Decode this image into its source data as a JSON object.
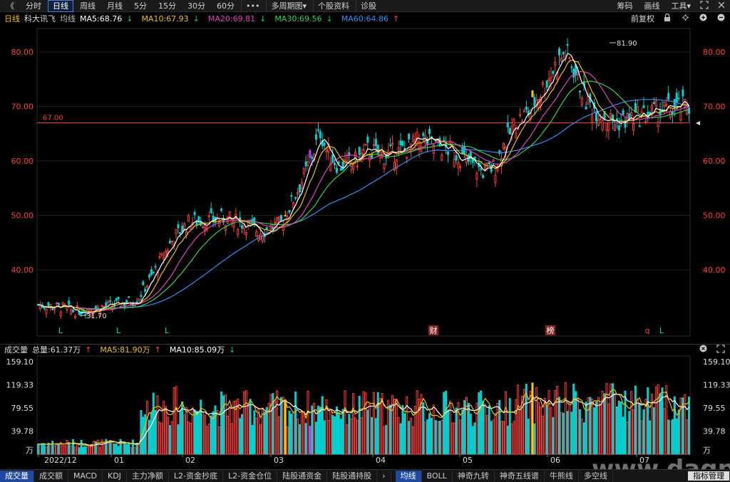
{
  "topbar": {
    "back_label": "《",
    "periods": [
      {
        "label": "分时",
        "active": false
      },
      {
        "label": "日线",
        "active": true
      },
      {
        "label": "周线",
        "active": false
      },
      {
        "label": "月线",
        "active": false
      },
      {
        "label": "5分",
        "active": false
      },
      {
        "label": "15分",
        "active": false
      },
      {
        "label": "30分",
        "active": false
      },
      {
        "label": "60分",
        "active": false
      }
    ],
    "more_label": "•••",
    "multi_period_label": "多周期图",
    "multi_period_arrow": "▾",
    "stock_info_label": "个股资料",
    "diagnose_label": "诊股",
    "chip_label": "筹码",
    "draw_label": "画线",
    "tools_label": "工具",
    "tools_arrow": "▾"
  },
  "ma_bar": {
    "chart_type": "日线",
    "stock_name": "科大讯飞",
    "ma_label": "均线",
    "ma5": "MA5:68.76",
    "ma5_arrow": "↓",
    "ma10": "MA10:67.93",
    "ma10_arrow": "↓",
    "ma20": "MA20:69.81",
    "ma20_arrow": "↓",
    "ma30": "MA30:69.56",
    "ma30_arrow": "↓",
    "ma60": "MA60:64.86",
    "ma60_arrow": "↑",
    "adjust_label": "前复权"
  },
  "vol_bar": {
    "title": "成交量",
    "total": "总量:61.37万",
    "total_arrow": "↑",
    "ma5": "MA5:81.90万",
    "ma5_arrow": "↑",
    "ma10": "MA10:85.09万",
    "ma10_arrow": "↓"
  },
  "colors": {
    "up": "#ff3b3b",
    "down": "#00d0d0",
    "special": "#b044ff",
    "gold": "#f0d000",
    "ma5": "#ffffff",
    "ma10": "#f0c000",
    "ma20": "#e040c0",
    "ma30": "#30d050",
    "ma60": "#2f8ff0",
    "ref_line": "#ff3b3b"
  },
  "price_axis": {
    "ticks": [
      "80.00",
      "70.00",
      "60.00",
      "50.00",
      "40.00"
    ],
    "ref_value": "67.00"
  },
  "annotations": {
    "high": "81.90",
    "low": "31.70",
    "events": [
      "L",
      "L",
      "L",
      "财",
      "榜",
      "q",
      "L"
    ]
  },
  "vol_axis": {
    "ticks": [
      "159.10",
      "119.33",
      "79.55",
      "39.78"
    ],
    "unit": "万"
  },
  "date_axis": [
    "2022/12",
    "01",
    "02",
    "03",
    "04",
    "05",
    "06",
    "07"
  ],
  "bottom_tabs": {
    "left": [
      "成交量",
      "成交额",
      "MACD",
      "KDJ",
      "主力净额",
      "L2-资金抄底",
      "L2-资金仓位",
      "陆股通资金",
      "陆股通持股"
    ],
    "scroll_arrow": "›",
    "right": [
      "均线",
      "BOLL",
      "神奇九转",
      "神奇五线谱",
      "牛熊线",
      "多空线"
    ],
    "manage": "指标管理"
  },
  "watermark": "www.dagp.net"
}
